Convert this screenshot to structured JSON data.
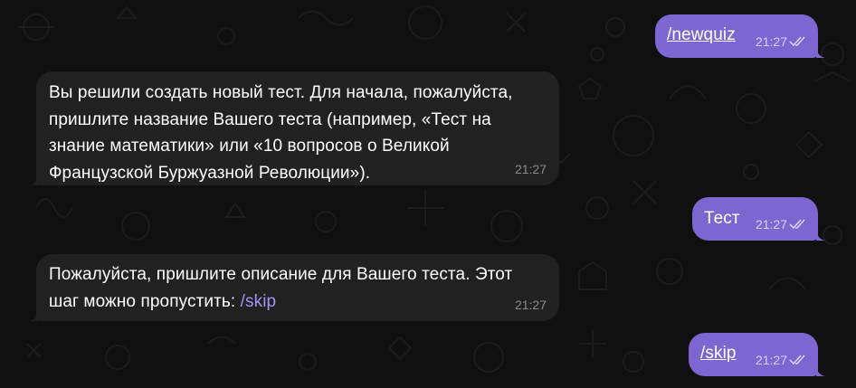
{
  "chat": {
    "messages": [
      {
        "id": "m1",
        "direction": "outgoing",
        "text": "/newquiz",
        "time": "21:27",
        "status": "read"
      },
      {
        "id": "m2",
        "direction": "incoming",
        "lines": [
          "Вы решили создать новый тест. Для начала, пожалуйста,",
          "пришлите название Вашего теста (например, «Тест на",
          "знание математики» или «10 вопросов о Великой",
          "Французской Буржуазной Революции»)."
        ],
        "time": "21:27"
      },
      {
        "id": "m3",
        "direction": "outgoing",
        "text": "Тест",
        "time": "21:27",
        "status": "read"
      },
      {
        "id": "m4",
        "direction": "incoming",
        "line1": "Пожалуйста, пришлите описание для Вашего теста. Этот",
        "line2_prefix": "шаг можно пропустить: ",
        "line2_link": "/skip",
        "time": "21:27"
      },
      {
        "id": "m5",
        "direction": "outgoing",
        "text": "/skip",
        "time": "21:27",
        "status": "read"
      }
    ]
  },
  "colors": {
    "background": "#101010",
    "outgoing_bubble": "#7b67cf",
    "incoming_bubble": "#212121",
    "link": "#a592f5"
  },
  "icons": [
    "double-check-icon",
    "chat-background-doodle-pattern"
  ]
}
